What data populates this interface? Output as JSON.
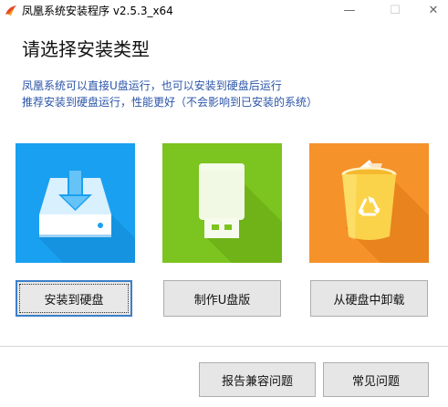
{
  "window": {
    "title": "凤凰系统安装程序 v2.5.3_x64",
    "controls": {
      "minimize": "—",
      "maximize": "☐",
      "close": "✕"
    }
  },
  "main": {
    "heading": "请选择安装类型",
    "description": [
      "凤凰系统可以直接U盘运行，也可以安装到硬盘后运行",
      "推荐安装到硬盘运行，性能更好（不会影响到已安装的系统）"
    ]
  },
  "options": [
    {
      "icon": "hard-disk-download-icon",
      "color": "#1aa0f0",
      "button_label": "安装到硬盘"
    },
    {
      "icon": "usb-drive-icon",
      "color": "#7cc41f",
      "button_label": "制作U盘版"
    },
    {
      "icon": "recycle-bin-icon",
      "color": "#f5922a",
      "button_label": "从硬盘中卸载"
    }
  ],
  "footer": {
    "report_label": "报告兼容问题",
    "faq_label": "常见问题"
  }
}
